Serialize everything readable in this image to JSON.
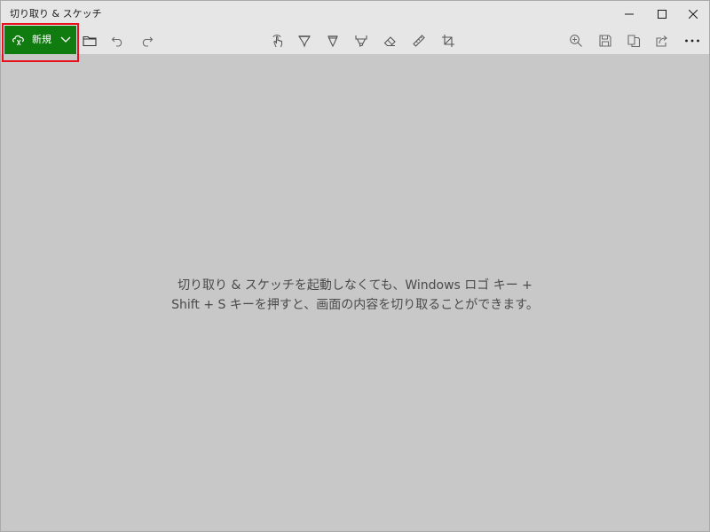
{
  "window": {
    "title": "切り取り & スケッチ"
  },
  "toolbar": {
    "new_label": "新規",
    "icons": [
      "new-snip-icon",
      "chevron-down-icon",
      "open-folder-icon",
      "undo-icon",
      "redo-icon",
      "touch-writing-icon",
      "ballpoint-pen-icon",
      "pencil-icon",
      "highlighter-icon",
      "eraser-icon",
      "ruler-icon",
      "crop-icon",
      "zoom-icon",
      "save-icon",
      "copy-icon",
      "share-icon",
      "more-icon"
    ]
  },
  "message": {
    "line1": "切り取り & スケッチを起動しなくても、Windows ロゴ キー +",
    "line2": "Shift + S キーを押すと、画面の内容を切り取ることができます。"
  },
  "colors": {
    "accent": "#107c10",
    "highlight_outline": "#e8101b",
    "toolbar_bg": "#e6e6e6",
    "canvas_bg": "#c8c8c8"
  }
}
